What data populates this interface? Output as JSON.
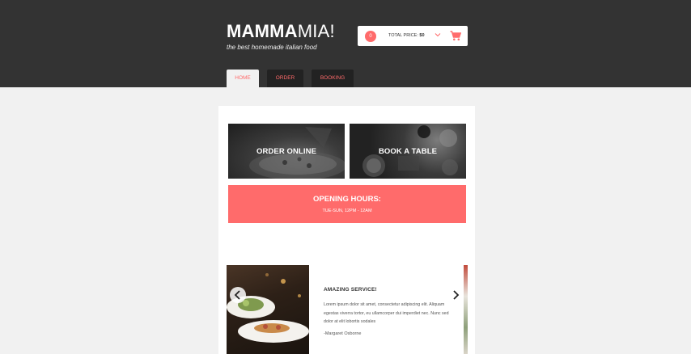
{
  "brand": {
    "name_bold": "MAMMA",
    "name_light": "MIA!",
    "tagline": "the best homemade italian food",
    "accent": "#ff6b6b",
    "header_bg": "#333333"
  },
  "cart": {
    "count": "0",
    "total_label": "TOTAL PRICE:",
    "total_value": "$0",
    "icons": [
      "chevron-down-icon",
      "shopping-cart-icon"
    ]
  },
  "nav": {
    "tabs": [
      {
        "label": "HOME",
        "active": true
      },
      {
        "label": "ORDER",
        "active": false
      },
      {
        "label": "BOOKING",
        "active": false
      }
    ]
  },
  "tiles": {
    "order_label": "ORDER ONLINE",
    "book_label": "BOOK A TABLE"
  },
  "hours": {
    "title": "OPENING HOURS:",
    "time": "TUE-SUN, 12PM - 12AM"
  },
  "testimonial": {
    "title": "AMAZING SERVICE!",
    "text": "Lorem ipsum dolor sit amet, consectetur adipiscing elit. Aliquam egestas viverra tortor, eu ullamcorper dui imperdiet nec. Nunc sed dolor at elit lobortis sodales",
    "author": "-Margaret Osborne",
    "icons": [
      "chevron-left-icon",
      "chevron-right-icon"
    ]
  }
}
